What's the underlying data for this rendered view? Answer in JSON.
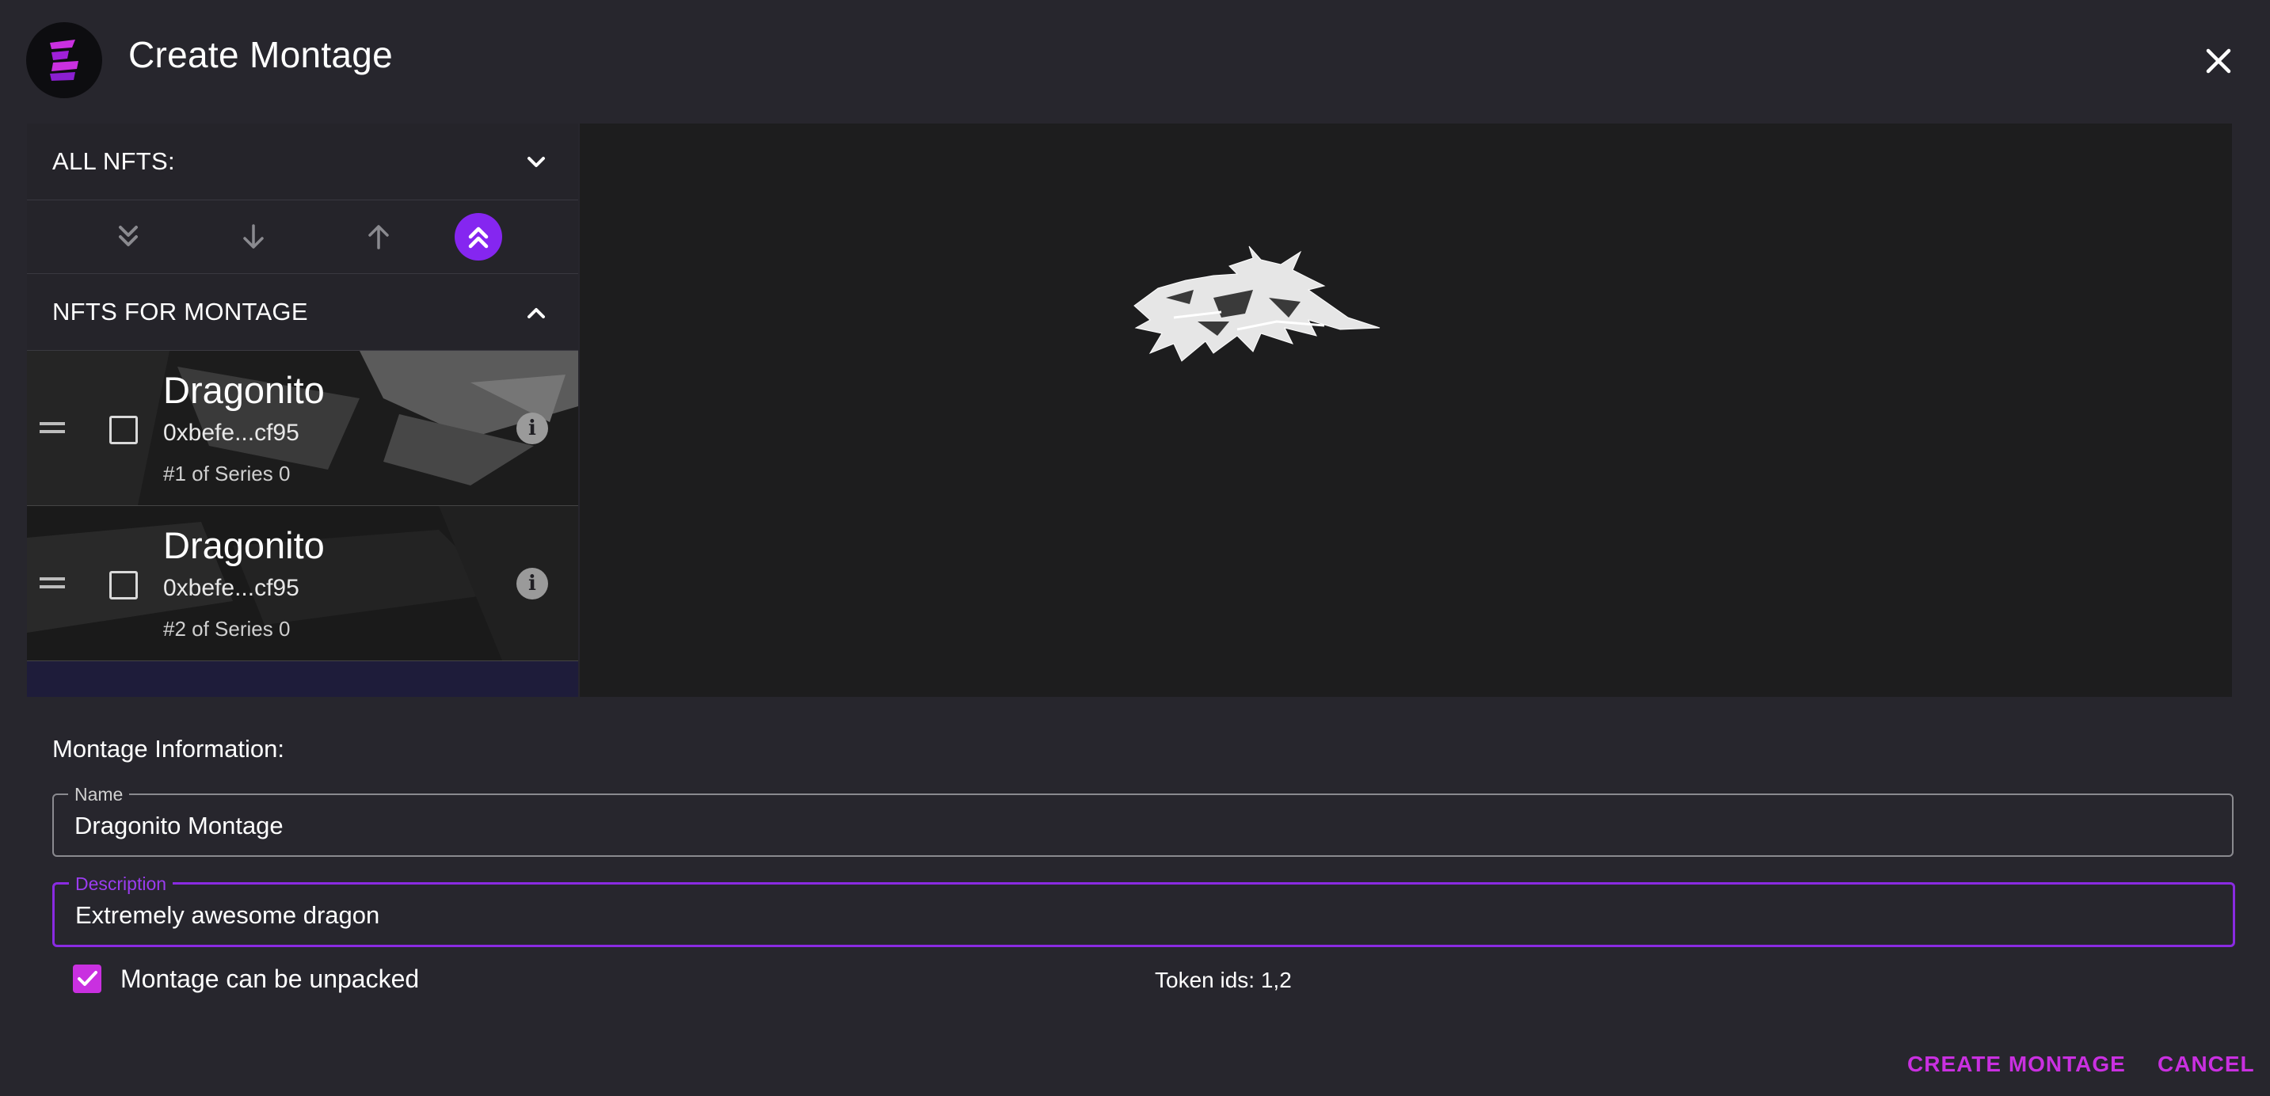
{
  "dialog": {
    "title": "Create Montage",
    "close_icon": "close-icon"
  },
  "left_panel": {
    "all_nfts_label": "ALL NFTS:",
    "montage_label": "NFTS FOR MONTAGE",
    "tools": [
      "double-chevron-down-icon",
      "arrow-down-icon",
      "arrow-up-icon",
      "double-chevron-up-icon"
    ],
    "nfts": [
      {
        "name": "Dragonito",
        "address": "0xbefe...cf95",
        "series": "#1 of Series 0"
      },
      {
        "name": "Dragonito",
        "address": "0xbefe...cf95",
        "series": "#2 of Series 0"
      }
    ]
  },
  "form": {
    "section_title": "Montage Information:",
    "name_label": "Name",
    "name_value": "Dragonito Montage",
    "description_label": "Description",
    "description_value": "Extremely awesome dragon",
    "unpack_label": "Montage can be unpacked",
    "unpack_checked": true,
    "token_ids": "Token ids: 1,2"
  },
  "actions": {
    "create_label": "CREATE MONTAGE",
    "cancel_label": "CANCEL"
  },
  "colors": {
    "accent": "#c930e0",
    "active_tool": "#8526f0",
    "background": "#27262d"
  }
}
